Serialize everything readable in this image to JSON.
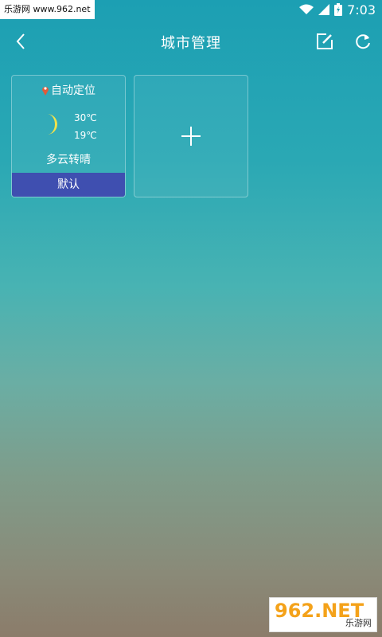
{
  "status_bar": {
    "watermark": "乐游网 www.962.net",
    "time": "7:03",
    "icons": [
      "wifi-icon",
      "signal-icon",
      "battery-icon"
    ]
  },
  "header": {
    "title": "城市管理",
    "icons": [
      "back-icon",
      "edit-icon",
      "refresh-icon"
    ]
  },
  "city_card": {
    "location_label": "自动定位",
    "high_temp": "30℃",
    "low_temp": "19℃",
    "condition": "多云转晴",
    "default_label": "默认"
  },
  "add_card": {
    "icon": "plus-icon"
  },
  "logo": {
    "big": "962.NET",
    "sub": "乐游网"
  },
  "colors": {
    "default_button": "#3f4fb0",
    "moon": "#f2e24a",
    "pin": "#e05a3a"
  }
}
